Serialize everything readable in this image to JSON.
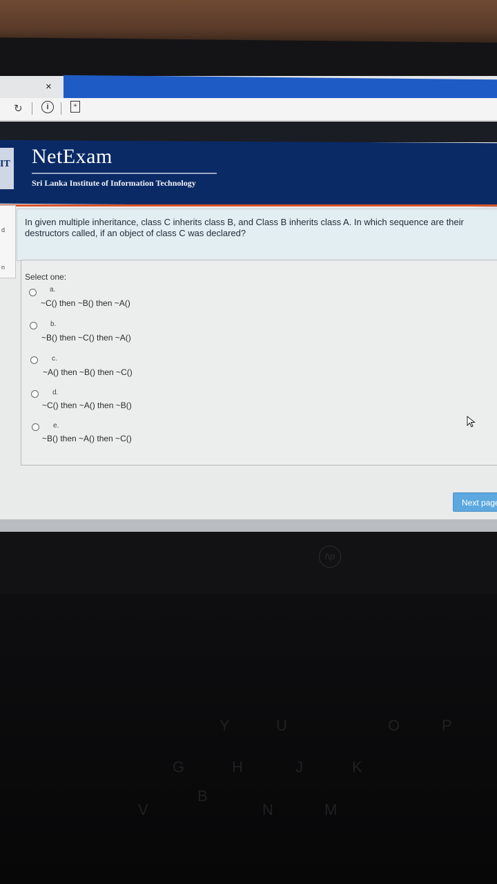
{
  "browser": {
    "close_glyph": "×",
    "reload_glyph": "↻",
    "info_glyph": "i",
    "page_glyph": "+"
  },
  "header": {
    "brand": "NetExam",
    "subtitle": "Sri Lanka Institute of Information Technology",
    "logo_letters": "IT"
  },
  "sidebar": {
    "frag1": "d",
    "frag2": "n"
  },
  "question": {
    "text": "In given multiple inheritance, class C inherits class B, and Class B inherits class A. In which sequence are their destructors called, if an object of class C was declared?",
    "select_label": "Select one:",
    "options": [
      {
        "letter": "a.",
        "text": "~C() then ~B() then ~A()"
      },
      {
        "letter": "b.",
        "text": "~B() then ~C() then ~A()"
      },
      {
        "letter": "c.",
        "text": "~A() then ~B() then ~C()"
      },
      {
        "letter": "d.",
        "text": "~C() then ~A() then ~B()"
      },
      {
        "letter": "e.",
        "text": "~B() then ~A() then ~C()"
      }
    ]
  },
  "next_button": "Next page",
  "laptop": {
    "logo": "hp",
    "keys": [
      "Y",
      "U",
      "O",
      "P",
      "G",
      "H",
      "J",
      "K",
      "V",
      "B",
      "N",
      "M"
    ]
  },
  "colors": {
    "header_bg": "#0a2a66",
    "accent_line": "#d9532c",
    "tab_blue": "#1f5bc4",
    "button_bg": "#5ca8df"
  }
}
